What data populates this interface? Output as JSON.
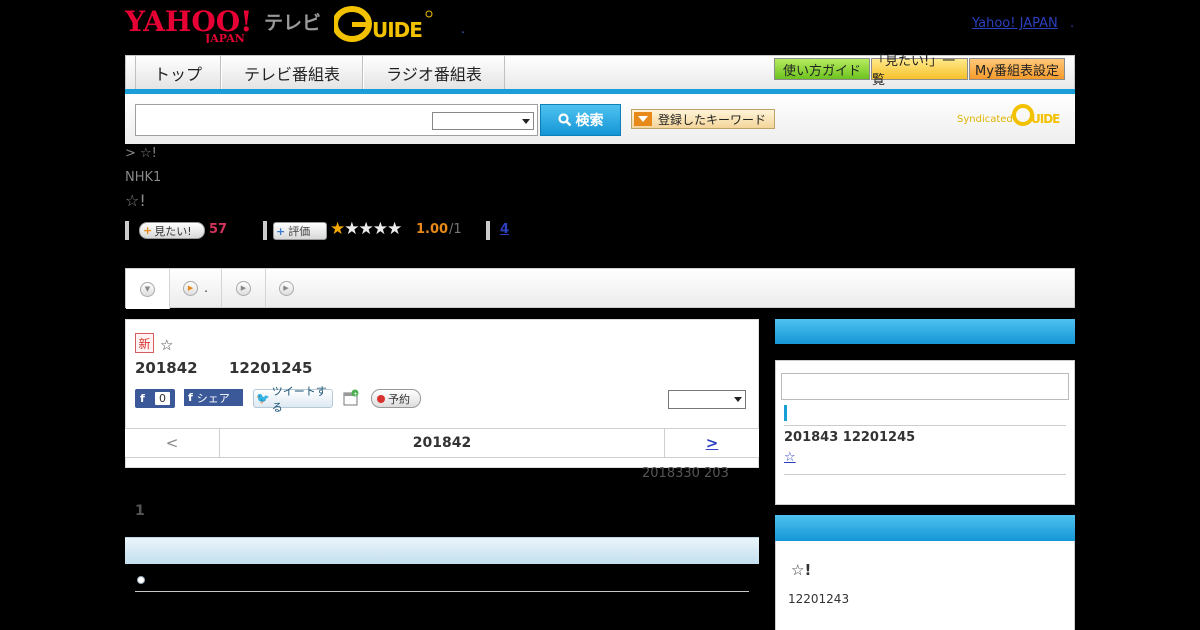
{
  "header": {
    "logo_yahoo": "YAHOO!",
    "logo_japan": "JAPAN",
    "logo_tv": "テレビ",
    "logo_gguide": "G GUIDE",
    "separator": ".",
    "yahoo_link": "Yahoo! JAPAN",
    "yahoo_link_suffix": "."
  },
  "nav": {
    "tabs": [
      "トップ",
      "テレビ番組表",
      "ラジオ番組表"
    ],
    "buttons": [
      "使い方ガイド",
      "「見たい!」一覧",
      "My番組表設定"
    ]
  },
  "search": {
    "button_label": "検索",
    "keyword_label": "登録したキーワード",
    "syndicated": "Syndicated"
  },
  "program": {
    "breadcrumb": "> ☆!",
    "channel": "NHK1",
    "title": "☆!"
  },
  "stats": {
    "mitai_label": "見たい!",
    "mitai_count": "57",
    "rate_label": "評価",
    "rating": 1,
    "rating_max": 5,
    "rating_value": "1.00",
    "rating_total": "/1",
    "review_count": "4"
  },
  "tab_strip": {
    "tab2_label": "."
  },
  "card": {
    "new_label": "新",
    "star": "☆",
    "date": "201842",
    "time": "12201245",
    "fb_like_count": "0",
    "fb_share_label": "シェア",
    "tweet_label": "ツイートする",
    "reserve_label": "予約"
  },
  "pager": {
    "prev": "<",
    "date": "201842",
    "next": ">"
  },
  "updated": "2018330  203",
  "count_one": "1",
  "sidebar": {
    "next_date": "201843  12201245",
    "next_link": "☆          ",
    "program_title": "☆!",
    "program_time": "12201243"
  }
}
